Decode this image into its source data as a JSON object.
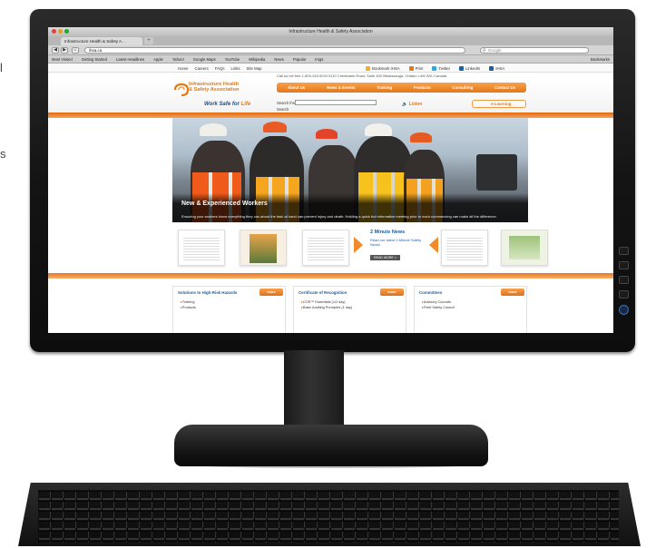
{
  "edge": {
    "frag1": "l",
    "frag2": "s"
  },
  "browser": {
    "window_title": "Infrastructure Health & Safety Association",
    "tab_label": "Infrastructure Health & Safety A...",
    "new_tab": "+",
    "url": "ihsa.ca",
    "search_placeholder": "Google",
    "bookmarks": [
      "Most Visited",
      "Getting Started",
      "Latest Headlines",
      "Apple",
      "Yahoo!",
      "Google Maps",
      "YouTube",
      "Wikipedia",
      "News",
      "Popular",
      "Imgs"
    ],
    "bookmarks_right": "Bookmarks"
  },
  "site": {
    "utility_links": [
      "Home",
      "Careers",
      "FAQs",
      "Links",
      "Site Map"
    ],
    "utility_right": [
      "Bookmark IHSA",
      "Print",
      "Twitter",
      "LinkedIn",
      "IHSA"
    ],
    "contact_line": "Call us toll free 1-800-263-5024  5110 Creekbank Road, Suite 400 Mississauga, Ontario L4W 0A1 Canada",
    "logo_line1": "Infrastructure Health",
    "logo_line2": "& Safety Association",
    "tagline_a": "Work Safe for ",
    "tagline_b": "Life",
    "nav": [
      "About Us",
      "News & Events",
      "Training",
      "Products",
      "Consulting",
      "Contact Us"
    ],
    "search_label": "Search ihsa",
    "search_button": "Search",
    "listen": "Listen",
    "elearning": "e-Learning",
    "hero_title": "New & Experienced Workers",
    "hero_text": "Ensuring your workers know everything they can about the task at hand can prevent injury and death. Holding a quick but informative meeting prior to each commencing can make all the difference.",
    "feature_title": "2 Minute News",
    "feature_text": "Read our latest 2-Minute Safety News!",
    "read_more": "READ MORE >",
    "boxes": [
      {
        "title": "Solutions to High-Risk Hazards",
        "button": "more",
        "items": [
          "Training",
          "Products"
        ]
      },
      {
        "title": "Certificate of Recognition",
        "button": "more",
        "items": [
          "COR™ Essentials (1/2 day)",
          "Basic Auditing Principles (1 day)"
        ]
      },
      {
        "title": "Committees",
        "button": "more",
        "items": [
          "Advisory Councils",
          "Fleet Safety Council"
        ]
      }
    ]
  },
  "colors": {
    "brand_orange": "#e07b14",
    "brand_blue": "#1f4f7f",
    "monitor": "#141414"
  }
}
